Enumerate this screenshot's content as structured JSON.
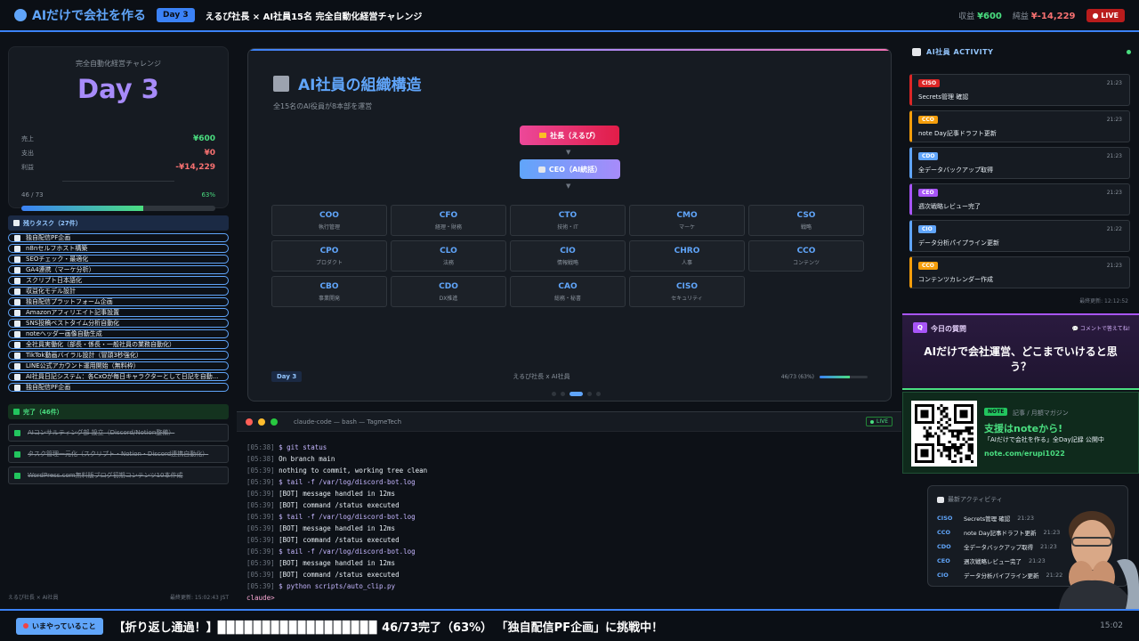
{
  "topbar": {
    "logo": "AIだけで会社を作る",
    "day_badge": "Day 3",
    "title": "えるぴ社長 × AI社員15名 完全自動化経営チャレンジ",
    "revenue_label": "収益",
    "revenue_value": "¥600",
    "net_label": "純益",
    "net_value": "¥-14,229",
    "live": "● LIVE"
  },
  "daycard": {
    "label": "完全自動化経営チャレンジ",
    "day": "Day 3",
    "sales_label": "売上",
    "sales_value": "¥600",
    "expense_label": "支出",
    "expense_value": "¥0",
    "profit_label": "利益",
    "profit_value": "-¥14,229",
    "progress_text": "46 / 73",
    "progress_pct": "63%",
    "progress_fraction": 0.63
  },
  "tasks": {
    "header": "残りタスク（27件）",
    "items": [
      "独自配信PF企画",
      "n8nセルフホスト構築",
      "SEOチェック・最適化",
      "GA4連携（マーケ分析）",
      "スクリプト日本語化",
      "収益化モデル設計",
      "独自配信プラットフォーム企画",
      "Amazonアフィリエイト記事設置",
      "SNS投稿ベストタイム分析自動化",
      "noteヘッダー画像自動生成",
      "全社員実働化（部長・係長・一般社員の業務自動化）",
      "TikTok動画バイラル設計（冒頭3秒強化）",
      "LINE公式アカウント運用開始（無料枠）",
      "AI社員日記システム：各CxOが毎日キャラクターとして日記を自動...",
      "独自配信PF企画"
    ]
  },
  "done": {
    "header": "完了（46件）",
    "items": [
      "AIコンサルティング部 設立（Discord/Notion整備）",
      "タスク管理一元化（スクリプト・Notion・Discord連携自動化）",
      "WordPress.com無料版ブログ初期コンテンツ10本作成"
    ]
  },
  "left_footer": {
    "left": "えるぴ社長 × AI社員",
    "right": "最終更新: 15:02:43 JST"
  },
  "slide": {
    "title": "AI社員の組織構造",
    "subtitle": "全15名のAI役員が8本部を運営",
    "president": "社長（えるぴ）",
    "ceo": "CEO（AI統括）",
    "arrow": "▼",
    "roles": [
      {
        "role": "COO",
        "desc": "執行管理"
      },
      {
        "role": "CFO",
        "desc": "経理・財務"
      },
      {
        "role": "CTO",
        "desc": "技術・IT"
      },
      {
        "role": "CMO",
        "desc": "マーケ"
      },
      {
        "role": "CSO",
        "desc": "戦略"
      },
      {
        "role": "CPO",
        "desc": "プロダクト"
      },
      {
        "role": "CLO",
        "desc": "法務"
      },
      {
        "role": "CIO",
        "desc": "情報戦略"
      },
      {
        "role": "CHRO",
        "desc": "人事"
      },
      {
        "role": "CCO",
        "desc": "コンテンツ"
      },
      {
        "role": "CBO",
        "desc": "事業開発"
      },
      {
        "role": "CDO",
        "desc": "DX推進"
      },
      {
        "role": "CAO",
        "desc": "総務・秘書"
      },
      {
        "role": "CISO",
        "desc": "セキュリティ"
      }
    ],
    "footer_day": "Day 3",
    "footer_mid": "えるぴ社長 x AI社員",
    "footer_progress": "46/73 (63%)",
    "footer_fraction": 0.63
  },
  "terminal": {
    "title": "claude-code — bash — TagmeTech",
    "live": "LIVE",
    "lines": [
      {
        "ts": "[05:38]",
        "kind": "cmd",
        "text": "$ git status"
      },
      {
        "ts": "[05:38]",
        "kind": "out",
        "text": "On branch main"
      },
      {
        "ts": "[05:39]",
        "kind": "out",
        "text": "nothing to commit, working tree clean"
      },
      {
        "ts": "[05:39]",
        "kind": "cmd",
        "text": "$ tail -f /var/log/discord-bot.log"
      },
      {
        "ts": "[05:39]",
        "kind": "out",
        "text": "[BOT] message handled in 12ms"
      },
      {
        "ts": "[05:39]",
        "kind": "out",
        "text": "[BOT] command /status executed"
      },
      {
        "ts": "[05:39]",
        "kind": "cmd",
        "text": "$ tail -f /var/log/discord-bot.log"
      },
      {
        "ts": "[05:39]",
        "kind": "out",
        "text": "[BOT] message handled in 12ms"
      },
      {
        "ts": "[05:39]",
        "kind": "out",
        "text": "[BOT] command /status executed"
      },
      {
        "ts": "[05:39]",
        "kind": "cmd",
        "text": "$ tail -f /var/log/discord-bot.log"
      },
      {
        "ts": "[05:39]",
        "kind": "out",
        "text": "[BOT] message handled in 12ms"
      },
      {
        "ts": "[05:39]",
        "kind": "out",
        "text": "[BOT] command /status executed"
      },
      {
        "ts": "[05:39]",
        "kind": "cmd",
        "text": "$ python scripts/auto_clip.py"
      }
    ],
    "prompt": "claude>"
  },
  "activity": {
    "header": "AI社員 ACTIVITY",
    "items": [
      {
        "role": "CISO",
        "color": "#dc2626",
        "time": "21:23",
        "msg": "Secrets管理 確認"
      },
      {
        "role": "CCO",
        "color": "#f59e0b",
        "time": "21:23",
        "msg": "note Day記事ドラフト更新"
      },
      {
        "role": "CDO",
        "color": "#60a5fa",
        "time": "21:23",
        "msg": "全データバックアップ取得"
      },
      {
        "role": "CEO",
        "color": "#a855f7",
        "time": "21:23",
        "msg": "週次戦略レビュー完了"
      },
      {
        "role": "CIO",
        "color": "#60a5fa",
        "time": "21:22",
        "msg": "データ分析パイプライン更新"
      },
      {
        "role": "CCO",
        "color": "#f59e0b",
        "time": "21:23",
        "msg": "コンテンツカレンダー作成"
      }
    ],
    "updated": "最終更新: 12:12:52"
  },
  "question": {
    "badge": "Q",
    "label": "今日の質問",
    "hint": "💬 コメントで答えてね!",
    "text": "AIだけで会社運営、どこまでいけると思う？"
  },
  "note": {
    "badge": "NOTE",
    "category": "記事 / 月額マガジン",
    "headline": "支援はnoteから!",
    "sub": "「AIだけで会社を作る」全Day記録 公開中",
    "url": "note.com/erupi1022"
  },
  "mini_activity": {
    "header": "最新アクティビティ",
    "items": [
      {
        "role": "CISO",
        "msg": "Secrets管理 確認",
        "time": "21:23"
      },
      {
        "role": "CCO",
        "msg": "note Day記事ドラフト更新",
        "time": "21:23"
      },
      {
        "role": "CDO",
        "msg": "全データバックアップ取得",
        "time": "21:23"
      },
      {
        "role": "CEO",
        "msg": "週次戦略レビュー完了",
        "time": "21:23"
      },
      {
        "role": "CIO",
        "msg": "データ分析パイプライン更新",
        "time": "21:22"
      }
    ]
  },
  "bottom": {
    "now_label": "いまやっていること",
    "ticker": "【折り返し通過！】▉▉▉▉▉▉▉▉▉▉▉▉▉▉▉▉▉▉ 46/73完了（63%） 「独自配信PF企画」に挑戦中！",
    "clock": "15:02"
  },
  "colors": {
    "accent": "#3b82f6",
    "positive": "#4ade80",
    "negative": "#f87171",
    "purple": "#a78bfa"
  }
}
